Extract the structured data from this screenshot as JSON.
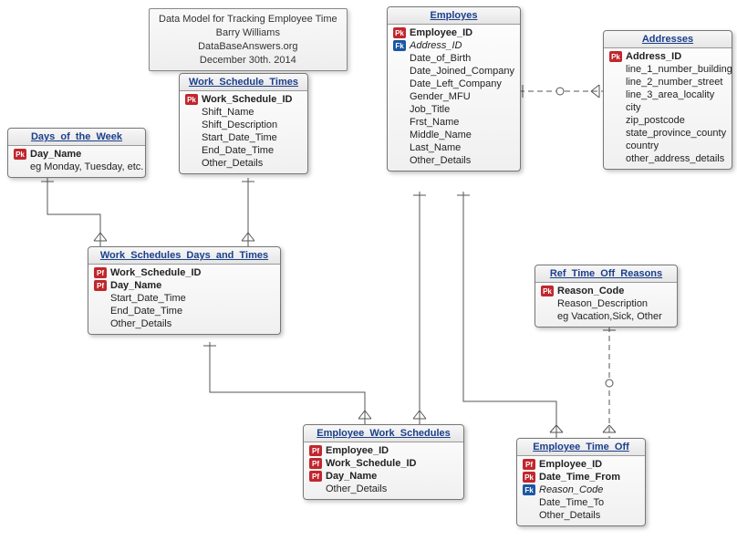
{
  "info_box": {
    "line1": "Data Model for Tracking Employee Time",
    "line2": "Barry Williams",
    "line3": "DataBaseAnswers.org",
    "line4": "December 30th. 2014"
  },
  "entities": {
    "employes": {
      "title": "Employes",
      "attrs": [
        {
          "key": "PK",
          "keyTxt": "Pk",
          "name": "Employee_ID",
          "style": "bold"
        },
        {
          "key": "FK",
          "keyTxt": "Fk",
          "name": "Address_ID",
          "style": "italic"
        },
        {
          "key": "",
          "name": "Date_of_Birth"
        },
        {
          "key": "",
          "name": "Date_Joined_Company"
        },
        {
          "key": "",
          "name": "Date_Left_Company"
        },
        {
          "key": "",
          "name": "Gender_MFU"
        },
        {
          "key": "",
          "name": "Job_Title"
        },
        {
          "key": "",
          "name": "Frst_Name"
        },
        {
          "key": "",
          "name": "Middle_Name"
        },
        {
          "key": "",
          "name": "Last_Name"
        },
        {
          "key": "",
          "name": "Other_Details"
        }
      ]
    },
    "addresses": {
      "title": "Addresses",
      "attrs": [
        {
          "key": "PK",
          "keyTxt": "Pk",
          "name": "Address_ID",
          "style": "bold"
        },
        {
          "key": "",
          "name": "line_1_number_building"
        },
        {
          "key": "",
          "name": "line_2_number_street"
        },
        {
          "key": "",
          "name": "line_3_area_locality"
        },
        {
          "key": "",
          "name": "city"
        },
        {
          "key": "",
          "name": "zip_postcode"
        },
        {
          "key": "",
          "name": "state_province_county"
        },
        {
          "key": "",
          "name": "country"
        },
        {
          "key": "",
          "name": "other_address_details"
        }
      ]
    },
    "work_schedule_times": {
      "title": "Work_Schedule_Times",
      "attrs": [
        {
          "key": "PK",
          "keyTxt": "Pk",
          "name": "Work_Schedule_ID",
          "style": "bold"
        },
        {
          "key": "",
          "name": "Shift_Name"
        },
        {
          "key": "",
          "name": "Shift_Description"
        },
        {
          "key": "",
          "name": "Start_Date_Time"
        },
        {
          "key": "",
          "name": "End_Date_Time"
        },
        {
          "key": "",
          "name": "Other_Details"
        }
      ]
    },
    "days_of_the_week": {
      "title": "Days_of_the_Week",
      "attrs": [
        {
          "key": "PK",
          "keyTxt": "Pk",
          "name": "Day_Name",
          "style": "bold"
        },
        {
          "key": "",
          "name": "eg Monday, Tuesday, etc."
        }
      ]
    },
    "work_schedules_days_and_times": {
      "title": "Work_Schedules_Days_and_Times",
      "attrs": [
        {
          "key": "PF",
          "keyTxt": "Pf",
          "name": "Work_Schedule_ID",
          "style": "bold"
        },
        {
          "key": "PF",
          "keyTxt": "Pf",
          "name": "Day_Name",
          "style": "bold"
        },
        {
          "key": "",
          "name": "Start_Date_Time"
        },
        {
          "key": "",
          "name": "End_Date_Time"
        },
        {
          "key": "",
          "name": "Other_Details"
        }
      ]
    },
    "employee_work_schedules": {
      "title": "Employee_Work_Schedules",
      "attrs": [
        {
          "key": "PF",
          "keyTxt": "Pf",
          "name": "Employee_ID",
          "style": "bold"
        },
        {
          "key": "PF",
          "keyTxt": "Pf",
          "name": "Work_Schedule_ID",
          "style": "bold"
        },
        {
          "key": "PF",
          "keyTxt": "Pf",
          "name": "Day_Name",
          "style": "bold"
        },
        {
          "key": "",
          "name": "Other_Details"
        }
      ]
    },
    "ref_time_off_reasons": {
      "title": "Ref_Time_Off_Reasons",
      "attrs": [
        {
          "key": "PK",
          "keyTxt": "Pk",
          "name": "Reason_Code",
          "style": "bold"
        },
        {
          "key": "",
          "name": "Reason_Description"
        },
        {
          "key": "",
          "name": "eg Vacation,Sick, Other"
        }
      ]
    },
    "employee_time_off": {
      "title": "Employee_Time_Off",
      "attrs": [
        {
          "key": "PF",
          "keyTxt": "Pf",
          "name": "Employee_ID",
          "style": "bold"
        },
        {
          "key": "PK",
          "keyTxt": "Pk",
          "name": "Date_Time_From",
          "style": "bold"
        },
        {
          "key": "FK",
          "keyTxt": "Fk",
          "name": "Reason_Code",
          "style": "italic"
        },
        {
          "key": "",
          "name": "Date_Time_To"
        },
        {
          "key": "",
          "name": "Other_Details"
        }
      ]
    }
  }
}
